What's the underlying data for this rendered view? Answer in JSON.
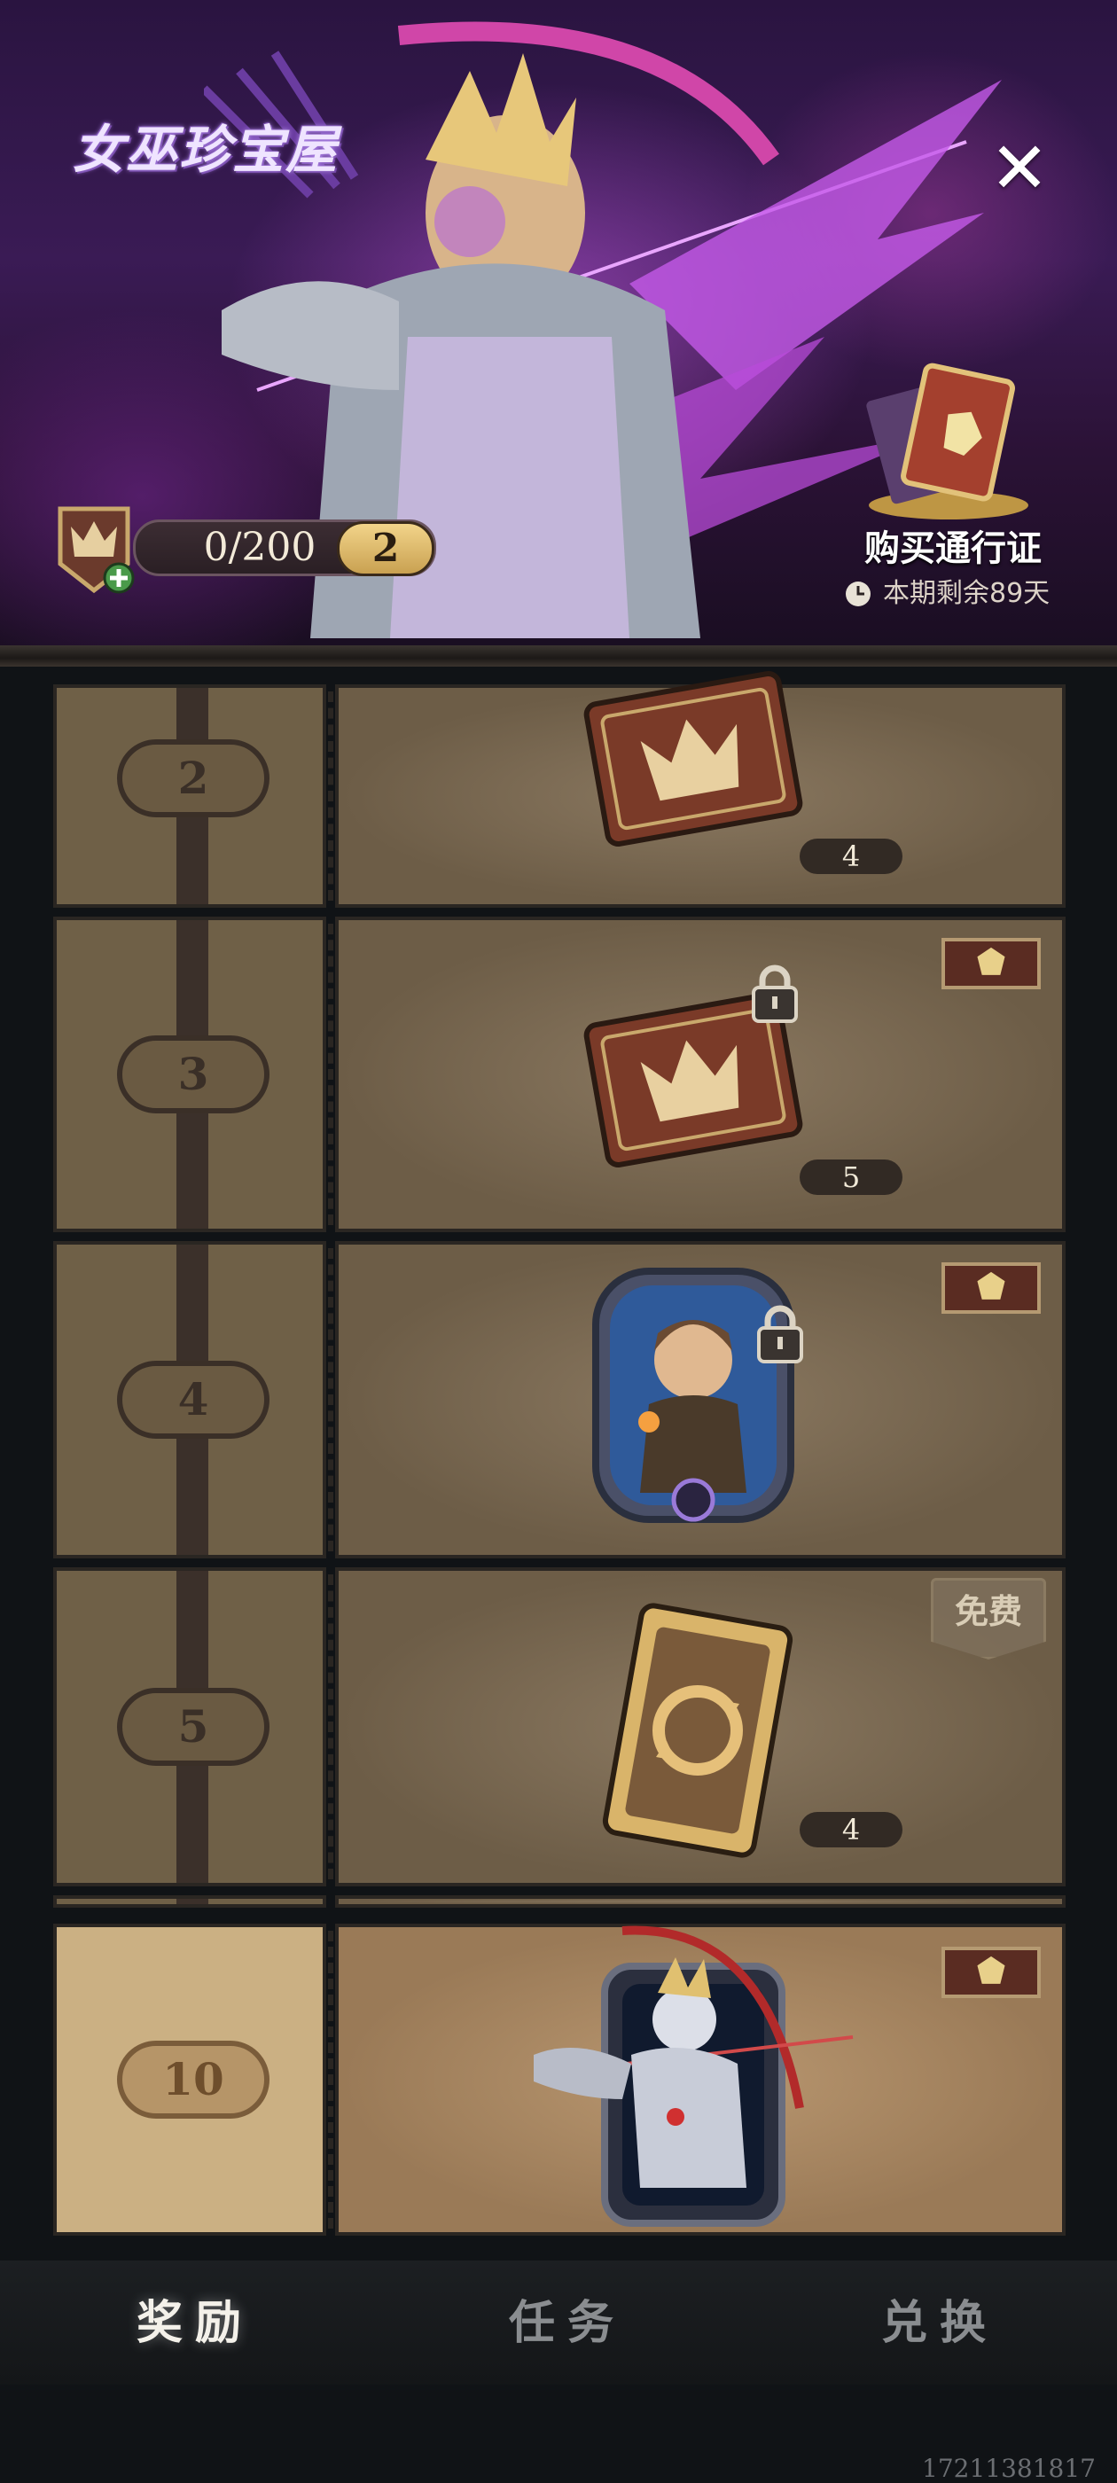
{
  "banner": {
    "logo_text": "女巫珍宝屋",
    "close_icon": "close-icon",
    "progress": {
      "current": 200,
      "max": 200,
      "text": "0/200",
      "fill_fraction": 0.0,
      "level": "2"
    },
    "buy_pass_label": "购买通行证",
    "remaining_text": "本期剩余89天"
  },
  "rewards": [
    {
      "level": "2",
      "item": "crown-card",
      "count": "4",
      "tag": "none",
      "locked": false
    },
    {
      "level": "3",
      "item": "crown-card",
      "count": "5",
      "tag": "premium",
      "locked": true
    },
    {
      "level": "4",
      "item": "hero-portrait-card",
      "count": "",
      "tag": "premium",
      "locked": true
    },
    {
      "level": "5",
      "item": "refresh-card",
      "count": "4",
      "tag": "free",
      "tag_label": "免费",
      "locked": false
    },
    {
      "level": "10",
      "item": "archer-hero-card",
      "count": "",
      "tag": "premium",
      "locked": false,
      "highlight": true
    }
  ],
  "tabs": [
    {
      "label": "奖励",
      "active": true
    },
    {
      "label": "任务",
      "active": false
    },
    {
      "label": "兑换",
      "active": false
    }
  ],
  "footer_id": "17211381817",
  "colors": {
    "accent_gold": "#c9a151",
    "panel_brown": "#6d5d47",
    "premium_red": "#5a2c22"
  }
}
